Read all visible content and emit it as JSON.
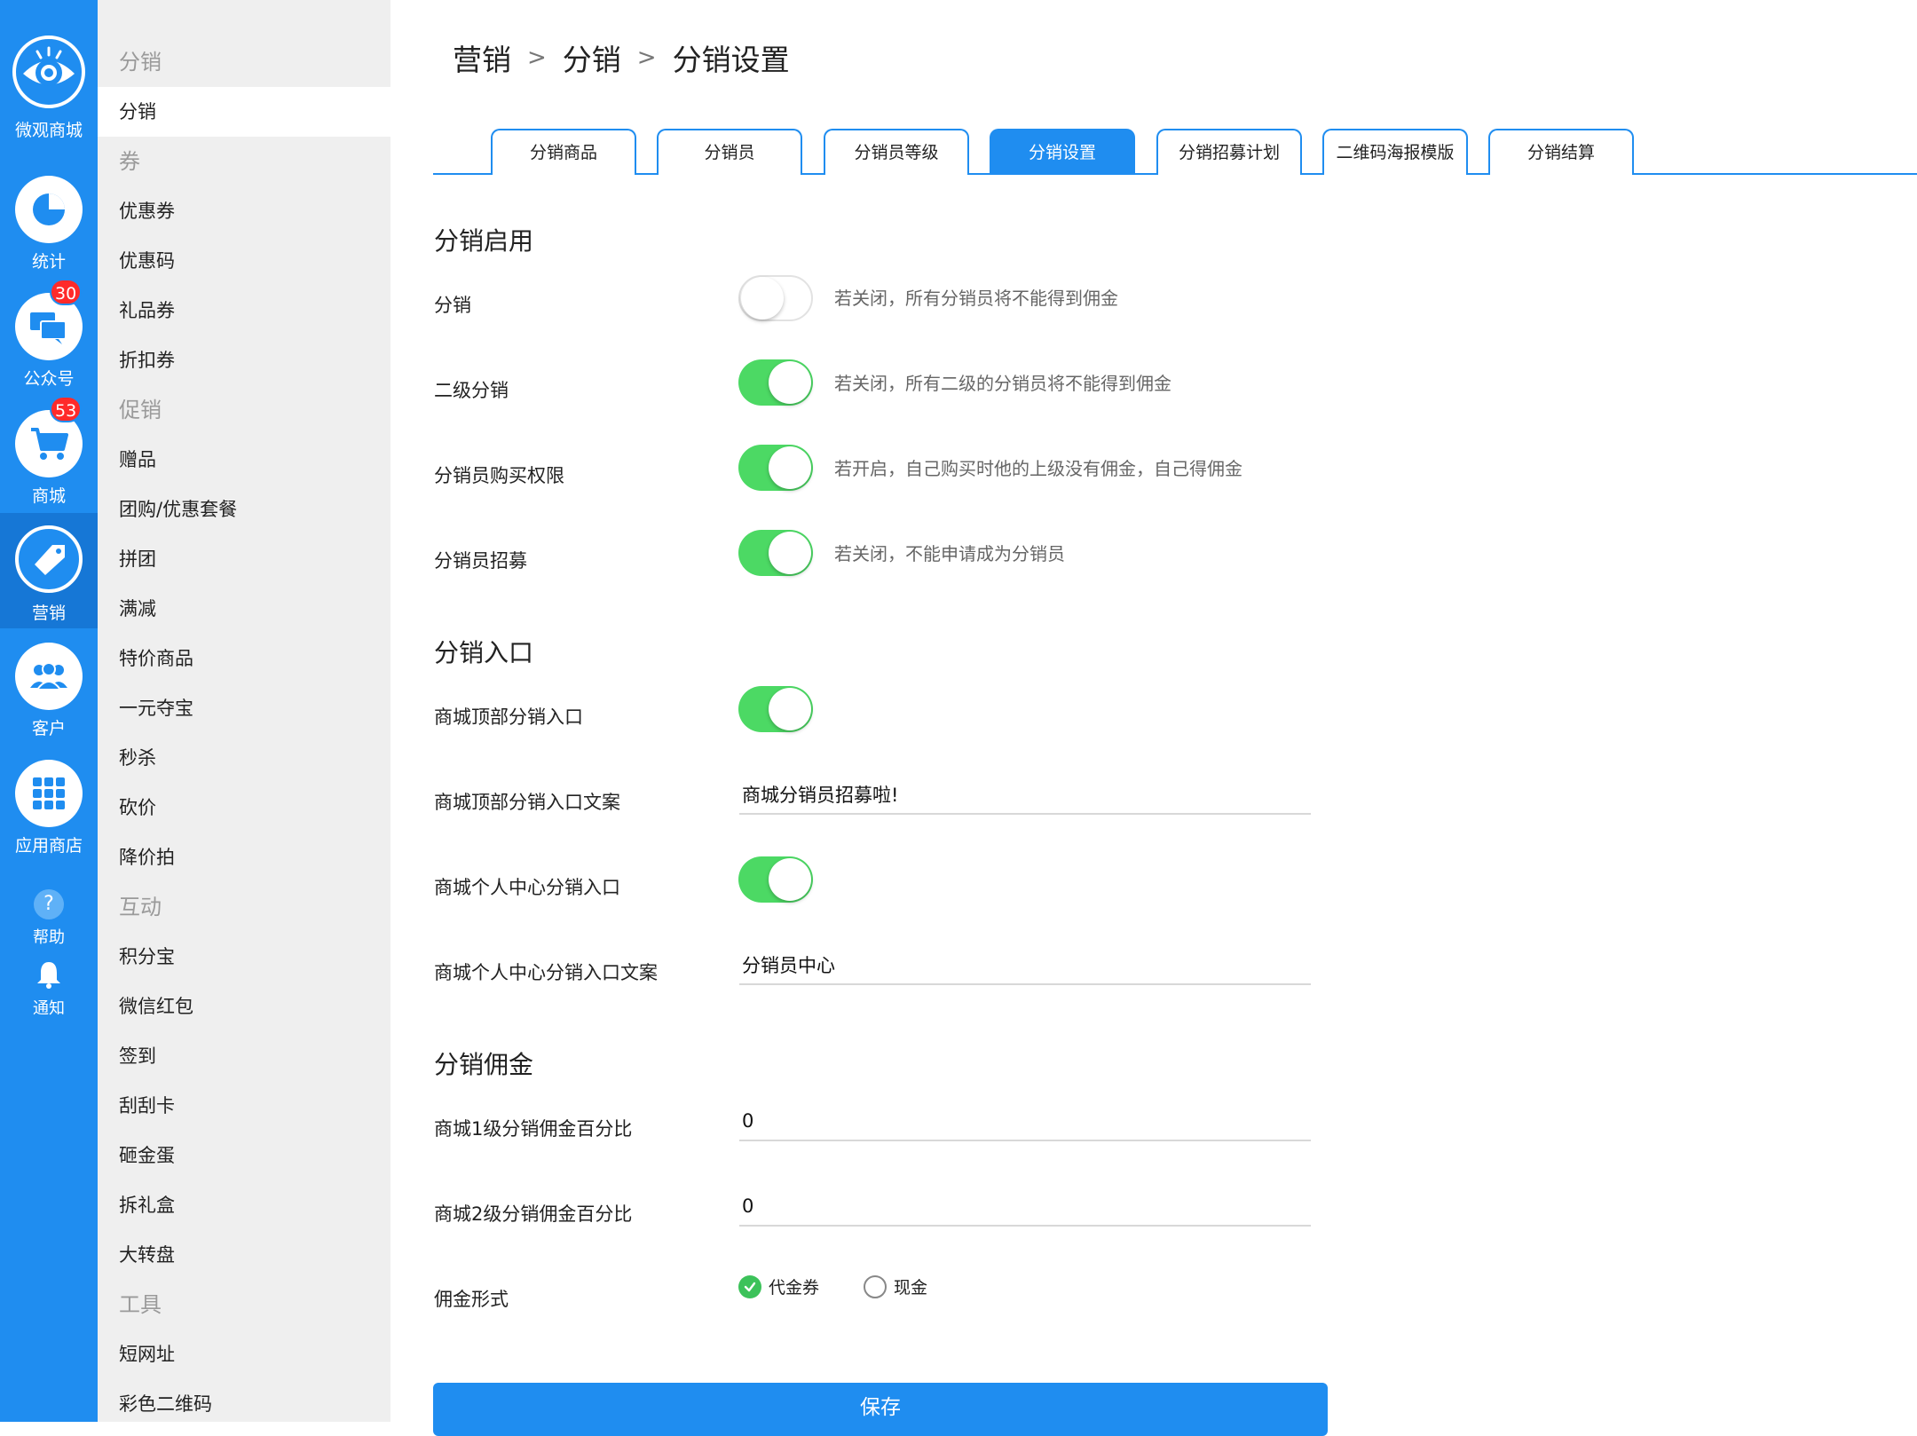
{
  "rail": {
    "logo_label": "微观商城",
    "items": [
      {
        "label": "统计",
        "icon": "pie-chart-icon"
      },
      {
        "label": "公众号",
        "icon": "chat-bubbles-icon",
        "badge": "30"
      },
      {
        "label": "商城",
        "icon": "shopping-cart-icon",
        "badge": "53"
      },
      {
        "label": "营销",
        "icon": "price-tag-icon"
      },
      {
        "label": "客户",
        "icon": "users-icon"
      },
      {
        "label": "应用商店",
        "icon": "app-grid-icon"
      }
    ],
    "help_label": "帮助",
    "notify_label": "通知"
  },
  "menu": {
    "rows": [
      {
        "text": "分销",
        "kind": "group"
      },
      {
        "text": "分销",
        "kind": "active"
      },
      {
        "text": "券",
        "kind": "group"
      },
      {
        "text": "优惠券",
        "kind": "item"
      },
      {
        "text": "优惠码",
        "kind": "item"
      },
      {
        "text": "礼品券",
        "kind": "item"
      },
      {
        "text": "折扣券",
        "kind": "item"
      },
      {
        "text": "促销",
        "kind": "group"
      },
      {
        "text": "赠品",
        "kind": "item"
      },
      {
        "text": "团购/优惠套餐",
        "kind": "item"
      },
      {
        "text": "拼团",
        "kind": "item"
      },
      {
        "text": "满减",
        "kind": "item"
      },
      {
        "text": "特价商品",
        "kind": "item"
      },
      {
        "text": "一元夺宝",
        "kind": "item"
      },
      {
        "text": "秒杀",
        "kind": "item"
      },
      {
        "text": "砍价",
        "kind": "item"
      },
      {
        "text": "降价拍",
        "kind": "item"
      },
      {
        "text": "互动",
        "kind": "group"
      },
      {
        "text": "积分宝",
        "kind": "item"
      },
      {
        "text": "微信红包",
        "kind": "item"
      },
      {
        "text": "签到",
        "kind": "item"
      },
      {
        "text": "刮刮卡",
        "kind": "item"
      },
      {
        "text": "砸金蛋",
        "kind": "item"
      },
      {
        "text": "拆礼盒",
        "kind": "item"
      },
      {
        "text": "大转盘",
        "kind": "item"
      },
      {
        "text": "工具",
        "kind": "group"
      },
      {
        "text": "短网址",
        "kind": "item"
      },
      {
        "text": "彩色二维码",
        "kind": "item"
      }
    ]
  },
  "breadcrumb": [
    "营销",
    "分销",
    "分销设置"
  ],
  "tabs": [
    "分销商品",
    "分销员",
    "分销员等级",
    "分销设置",
    "分销招募计划",
    "二维码海报模版",
    "分销结算"
  ],
  "active_tab_index": 3,
  "sections": {
    "enable": {
      "title": "分销启用",
      "fields": [
        {
          "label": "分销",
          "on": false,
          "hint": "若关闭，所有分销员将不能得到佣金"
        },
        {
          "label": "二级分销",
          "on": true,
          "hint": "若关闭，所有二级的分销员将不能得到佣金"
        },
        {
          "label": "分销员购买权限",
          "on": true,
          "hint": "若开启，自己购买时他的上级没有佣金，自己得佣金"
        },
        {
          "label": "分销员招募",
          "on": true,
          "hint": "若关闭，不能申请成为分销员"
        }
      ]
    },
    "entrance": {
      "title": "分销入口",
      "top_toggle_label": "商城顶部分销入口",
      "top_toggle_on": true,
      "top_text_label": "商城顶部分销入口文案",
      "top_text_value": "商城分销员招募啦!",
      "center_toggle_label": "商城个人中心分销入口",
      "center_toggle_on": true,
      "center_text_label": "商城个人中心分销入口文案",
      "center_text_value": "分销员中心"
    },
    "commission": {
      "title": "分销佣金",
      "level1_label": "商城1级分销佣金百分比",
      "level1_value": "0",
      "level2_label": "商城2级分销佣金百分比",
      "level2_value": "0",
      "form_label": "佣金形式",
      "options": [
        {
          "label": "代金券",
          "checked": true
        },
        {
          "label": "现金",
          "checked": false
        }
      ]
    }
  },
  "save_label": "保存",
  "colors": {
    "accent": "#1f8df0",
    "toggle_on": "#4cd964",
    "badge": "#ff2a2a",
    "radio_checked": "#3cc25a"
  }
}
